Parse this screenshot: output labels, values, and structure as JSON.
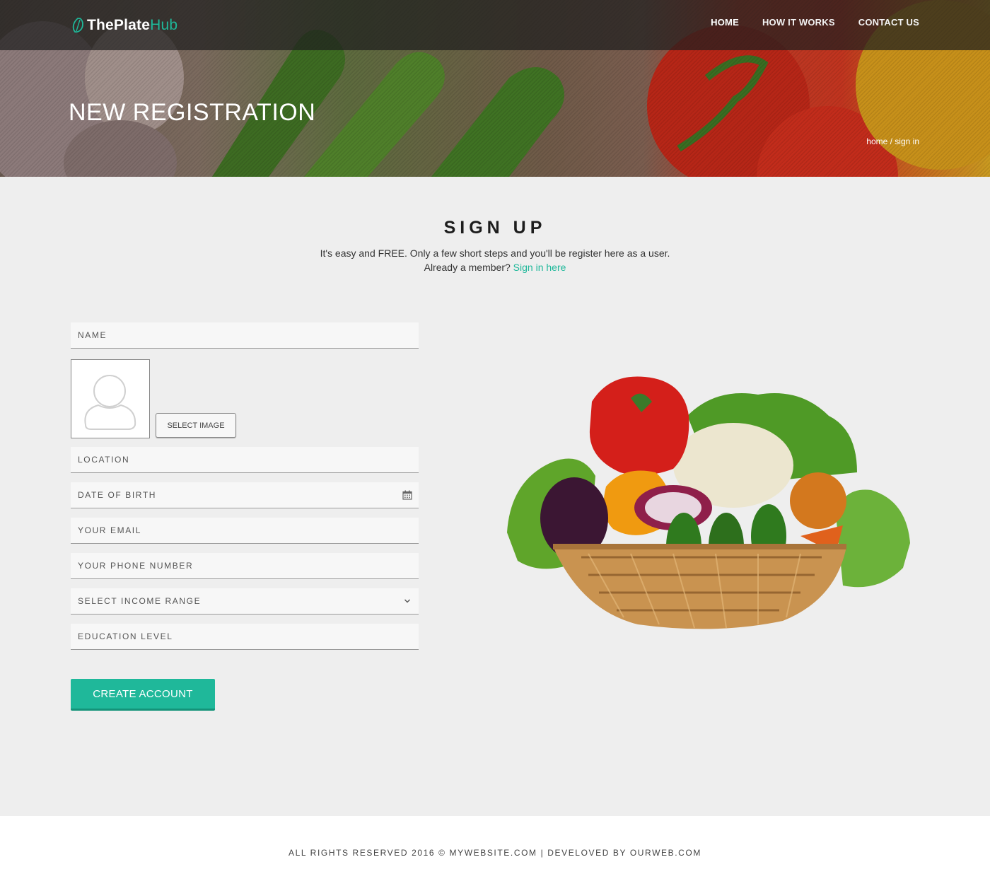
{
  "brand": {
    "name_part1": "ThePlate",
    "name_part2": "Hub",
    "accent_color": "#1fb89a"
  },
  "nav": {
    "items": [
      {
        "label": "HOME"
      },
      {
        "label": "HOW IT WORKS"
      },
      {
        "label": "CONTACT US"
      }
    ]
  },
  "hero": {
    "title": "NEW REGISTRATION",
    "breadcrumb": "home / sign in"
  },
  "signup": {
    "title": "SIGN UP",
    "line1": "It's easy and FREE. Only a few short steps and you'll be register here as a user.",
    "line2_prefix": "Already a member?",
    "signin_link": "Sign in here"
  },
  "form": {
    "name_placeholder": "NAME",
    "select_image_label": "SELECT IMAGE",
    "location_placeholder": "LOCATION",
    "dob_placeholder": "DATE OF BIRTH",
    "email_placeholder": "YOUR EMAIL",
    "phone_placeholder": "YOUR PHONE NUMBER",
    "income_selected": "SELECT INCOME RANGE",
    "education_placeholder": "EDUCATION LEVEL",
    "submit_label": "CREATE ACCOUNT",
    "icons": {
      "dob": "calendar-icon",
      "income": "chevron-down-icon",
      "avatar": "user-placeholder-icon"
    }
  },
  "footer": {
    "text": "ALL RIGHTS RESERVED 2016 © MYWEBSITE.COM | DEVELOVED BY OURWEB.COM"
  }
}
